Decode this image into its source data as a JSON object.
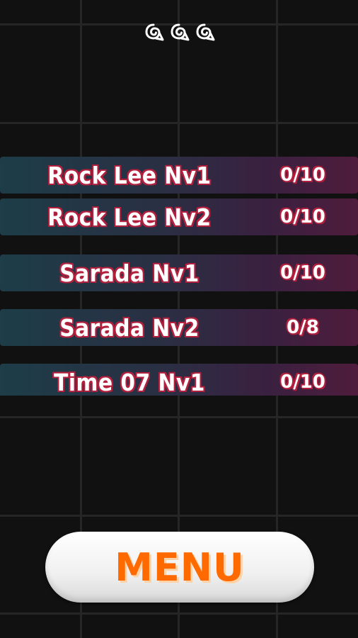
{
  "header": {
    "icons": [
      "konoha-leaf-icon",
      "konoha-leaf-icon",
      "konoha-leaf-icon"
    ]
  },
  "levels": [
    {
      "name": "Rock Lee Nv1",
      "progress": "0/10"
    },
    {
      "name": "Rock Lee Nv2",
      "progress": "0/10"
    },
    {
      "name": "Sarada Nv1",
      "progress": "0/10"
    },
    {
      "name": "Sarada Nv2",
      "progress": "0/8"
    },
    {
      "name": "Time 07 Nv1",
      "progress": "0/10"
    }
  ],
  "menu": {
    "label": "MENU"
  },
  "colors": {
    "background": "#111111",
    "row_start": "#1d3d48",
    "row_end": "#4f1c3c",
    "text_outline": "#b3203e",
    "menu_text": "#ff6a00"
  }
}
